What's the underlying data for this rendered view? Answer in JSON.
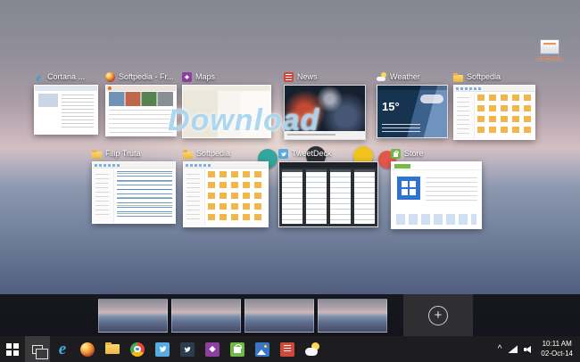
{
  "watermark": {
    "text": "Download"
  },
  "desktop": {
    "shortcut_label": "softpedia"
  },
  "icons": {
    "edge_glyph": "e",
    "ie_glyph": "e",
    "plus_glyph": "+",
    "tray_chevron": "^"
  },
  "taskview": {
    "windows": [
      {
        "title": "Cortana ..."
      },
      {
        "title": "Softpedia - Fr..."
      },
      {
        "title": "Maps"
      },
      {
        "title": "News"
      },
      {
        "title": "Weather",
        "temp": "15°"
      },
      {
        "title": "Softpedia"
      },
      {
        "title": "Filip Truta"
      },
      {
        "title": "Softpedia"
      },
      {
        "title": "TweetDeck"
      },
      {
        "title": "Store"
      }
    ]
  },
  "taskbar": {
    "clock": {
      "time": "10:11 AM",
      "date": "02-Oct-14"
    }
  }
}
